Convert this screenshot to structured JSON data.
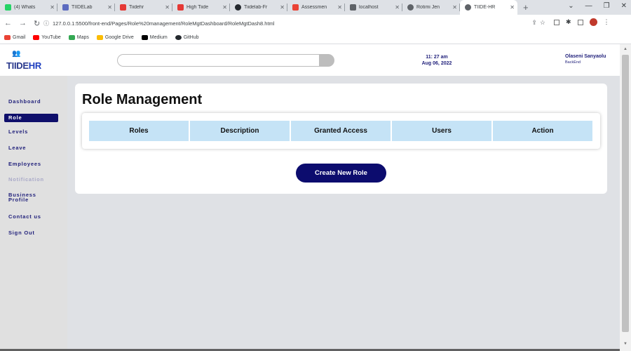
{
  "browser": {
    "tabs": [
      {
        "title": "(4) Whats",
        "icon_color": "#25d366",
        "icon": "whatsapp-icon"
      },
      {
        "title": "TIIDELab",
        "icon_color": "#5c6bc0",
        "icon": "tiidelab-icon"
      },
      {
        "title": "Tiidehr",
        "icon_color": "#e53935",
        "icon": "figma-icon"
      },
      {
        "title": "High Tiide",
        "icon_color": "#e53935",
        "icon": "pin-icon"
      },
      {
        "title": "Tiidelab-Fr",
        "icon_color": "#24292e",
        "icon": "github-icon"
      },
      {
        "title": "Assessmen",
        "icon_color": "#ea4335",
        "icon": "gmail-icon"
      },
      {
        "title": "localhost",
        "icon_color": "#5f6368",
        "icon": "page-icon"
      },
      {
        "title": "Rotimi Jen",
        "icon_color": "#5f6368",
        "icon": "globe-icon"
      },
      {
        "title": "TIIDE-HR",
        "icon_color": "#5f6368",
        "icon": "globe-icon"
      }
    ],
    "url": "127.0.0.1:5500/front-end/Pages/Role%20management/RoleMgtDashboard/RoleMgtDash8.html",
    "bookmarks": [
      {
        "label": "Gmail",
        "color": "#ea4335"
      },
      {
        "label": "YouTube",
        "color": "#ff0000"
      },
      {
        "label": "Maps",
        "color": "#34a853"
      },
      {
        "label": "Google Drive",
        "color": "#fbbc04"
      },
      {
        "label": "Medium",
        "color": "#000000"
      },
      {
        "label": "GitHub",
        "color": "#24292e"
      }
    ]
  },
  "header": {
    "logo_main": "TIIDE",
    "logo_accent": "HR",
    "time": "11: 27 am",
    "date": "Aug 06, 2022",
    "user_name": "Olaseni Sanyaolu",
    "user_role": "BackEnd"
  },
  "sidebar": {
    "items": [
      {
        "label": "Dashboard"
      },
      {
        "label": "Role"
      },
      {
        "label": "Levels"
      },
      {
        "label": "Leave"
      },
      {
        "label": "Employees"
      },
      {
        "label": "Notification"
      },
      {
        "label": "Business Profile"
      },
      {
        "label": "Contact us"
      },
      {
        "label": "Sign Out"
      }
    ],
    "active": "Role"
  },
  "main": {
    "title": "Role Management",
    "columns": [
      "Roles",
      "Description",
      "Granted Access",
      "Users",
      "Action"
    ],
    "create_button": "Create New Role"
  },
  "colors": {
    "primary": "#0c0c6e",
    "table_header": "#c5e3f6",
    "sidebar_bg": "#e0e0e0"
  }
}
